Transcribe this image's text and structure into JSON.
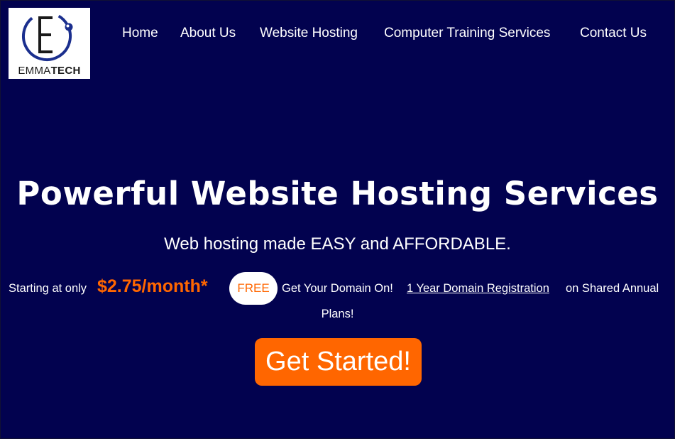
{
  "brand": {
    "logo_text_light": "EMMA",
    "logo_text_bold": "TECH",
    "colors": {
      "background": "#02024f",
      "accent": "#ff6600",
      "logo_blue": "#1b2f8e"
    }
  },
  "nav": {
    "items": [
      {
        "label": "Home"
      },
      {
        "label": "About Us"
      },
      {
        "label": "Website Hosting"
      },
      {
        "label": "Computer Training Services"
      },
      {
        "label": "Contact Us"
      }
    ]
  },
  "hero": {
    "title": "Powerful Website Hosting Services",
    "tagline": "Web hosting made EASY and AFFORDABLE.",
    "offer": {
      "prefix": "Starting at only",
      "price": "$2.75/month*",
      "badge": "FREE",
      "domain_text": "Get Your Domain On!",
      "link_text": "1 Year Domain Registration",
      "suffix": "on Shared Annual",
      "suffix_wrap": "Plans!"
    },
    "cta_label": "Get Started!"
  }
}
